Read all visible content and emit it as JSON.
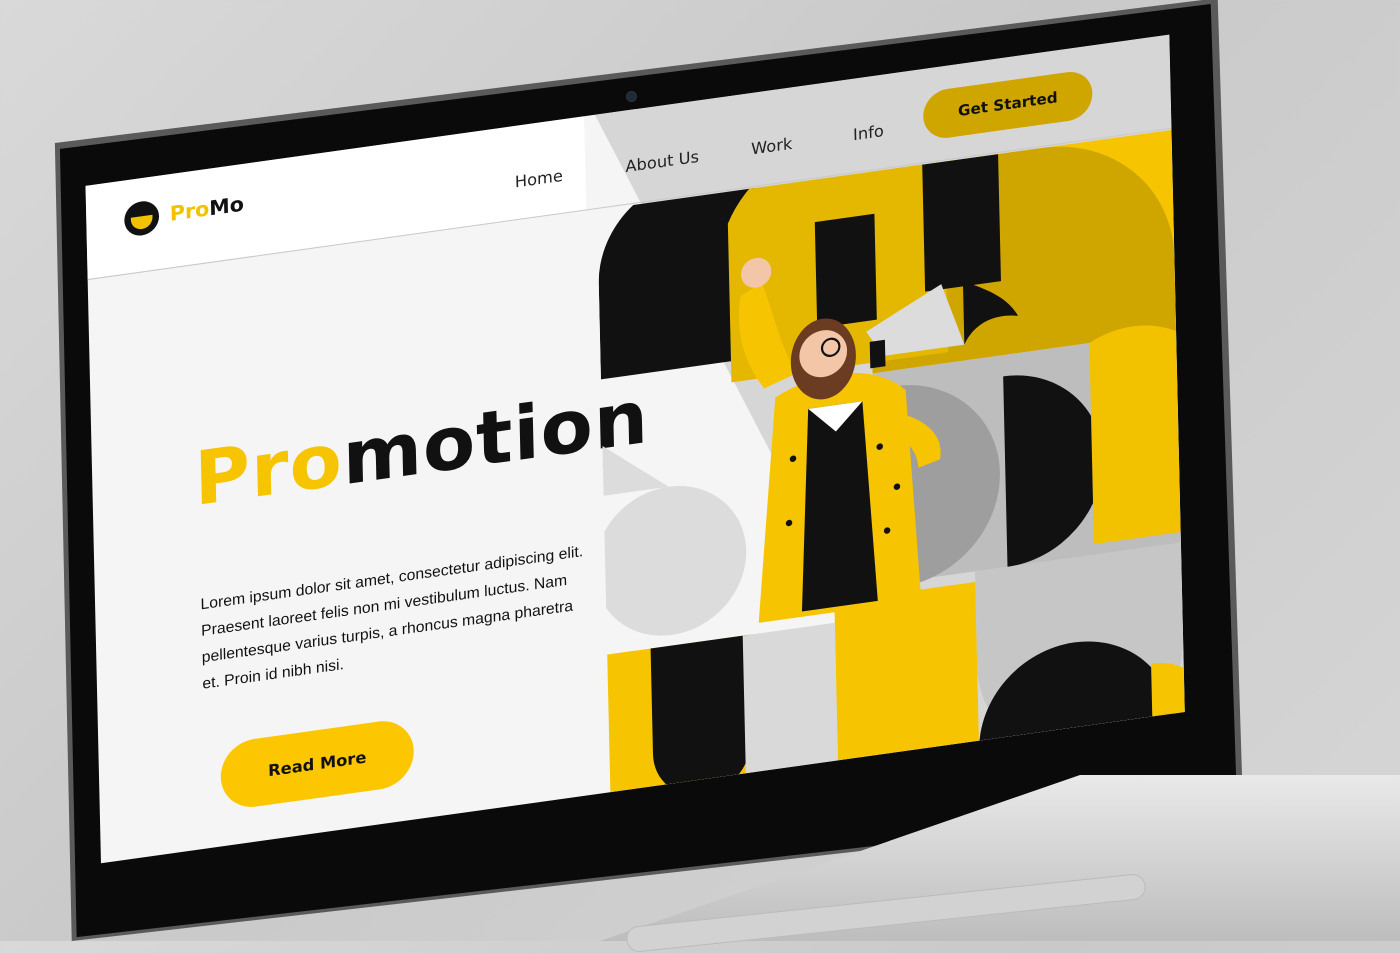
{
  "brand": {
    "name_prefix": "Pro",
    "name_suffix": "Mo",
    "icon": "logo-circle-icon"
  },
  "nav": {
    "items": [
      {
        "label": "Home"
      },
      {
        "label": "About Us"
      },
      {
        "label": "Work"
      },
      {
        "label": "Info"
      }
    ],
    "cta_label": "Get Started"
  },
  "hero": {
    "headline_accent": "Pro",
    "headline_rest": "motion",
    "body": "Lorem ipsum dolor sit amet, consectetur adipiscing elit. Praesent laoreet felis non mi vestibulum luctus. Nam pellentesque varius turpis, a rhoncus magna pharetra et. Proin id nibh nisi.",
    "button_label": "Read More",
    "illustration": "woman-with-megaphone-illustration"
  },
  "colors": {
    "accent": "#FCC700",
    "accent_dark": "#CFA500",
    "text": "#111111",
    "light_gray": "#D6D6D6",
    "mid_gray": "#A6A6A6"
  }
}
